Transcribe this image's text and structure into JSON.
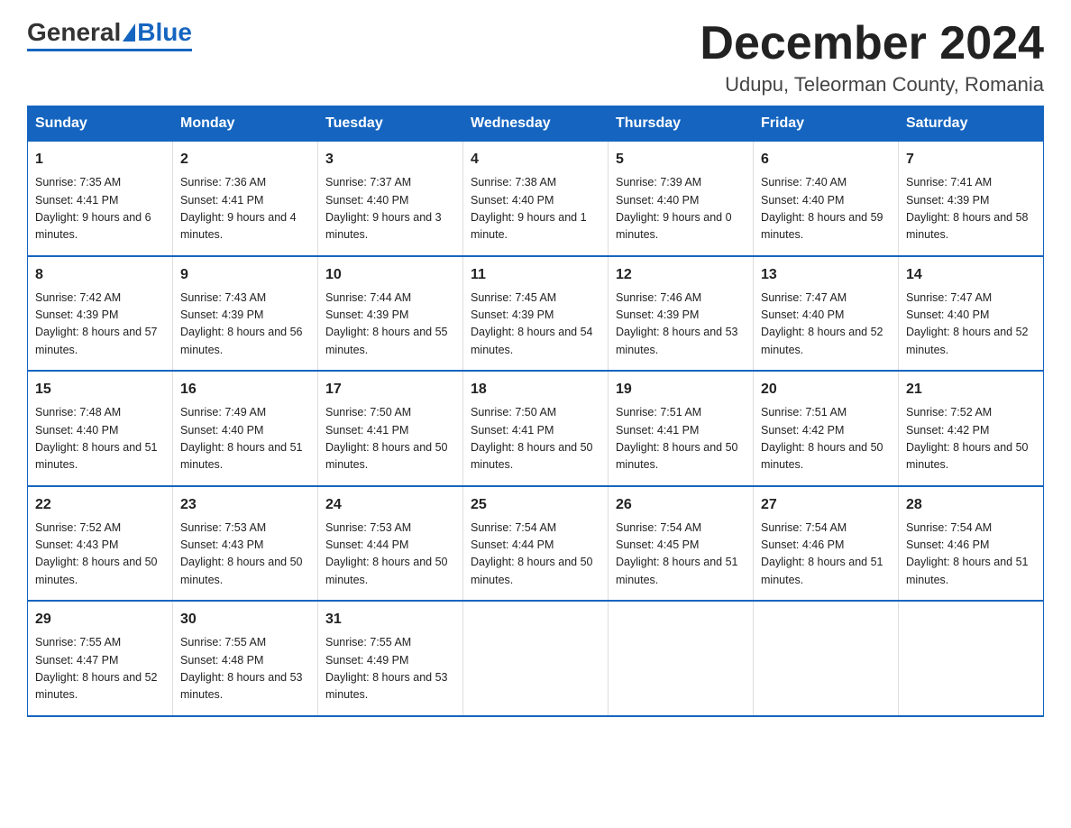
{
  "header": {
    "logo_general": "General",
    "logo_blue": "Blue",
    "month_title": "December 2024",
    "location": "Udupu, Teleorman County, Romania"
  },
  "weekdays": [
    "Sunday",
    "Monday",
    "Tuesday",
    "Wednesday",
    "Thursday",
    "Friday",
    "Saturday"
  ],
  "weeks": [
    [
      {
        "day": "1",
        "sunrise": "7:35 AM",
        "sunset": "4:41 PM",
        "daylight": "9 hours and 6 minutes."
      },
      {
        "day": "2",
        "sunrise": "7:36 AM",
        "sunset": "4:41 PM",
        "daylight": "9 hours and 4 minutes."
      },
      {
        "day": "3",
        "sunrise": "7:37 AM",
        "sunset": "4:40 PM",
        "daylight": "9 hours and 3 minutes."
      },
      {
        "day": "4",
        "sunrise": "7:38 AM",
        "sunset": "4:40 PM",
        "daylight": "9 hours and 1 minute."
      },
      {
        "day": "5",
        "sunrise": "7:39 AM",
        "sunset": "4:40 PM",
        "daylight": "9 hours and 0 minutes."
      },
      {
        "day": "6",
        "sunrise": "7:40 AM",
        "sunset": "4:40 PM",
        "daylight": "8 hours and 59 minutes."
      },
      {
        "day": "7",
        "sunrise": "7:41 AM",
        "sunset": "4:39 PM",
        "daylight": "8 hours and 58 minutes."
      }
    ],
    [
      {
        "day": "8",
        "sunrise": "7:42 AM",
        "sunset": "4:39 PM",
        "daylight": "8 hours and 57 minutes."
      },
      {
        "day": "9",
        "sunrise": "7:43 AM",
        "sunset": "4:39 PM",
        "daylight": "8 hours and 56 minutes."
      },
      {
        "day": "10",
        "sunrise": "7:44 AM",
        "sunset": "4:39 PM",
        "daylight": "8 hours and 55 minutes."
      },
      {
        "day": "11",
        "sunrise": "7:45 AM",
        "sunset": "4:39 PM",
        "daylight": "8 hours and 54 minutes."
      },
      {
        "day": "12",
        "sunrise": "7:46 AM",
        "sunset": "4:39 PM",
        "daylight": "8 hours and 53 minutes."
      },
      {
        "day": "13",
        "sunrise": "7:47 AM",
        "sunset": "4:40 PM",
        "daylight": "8 hours and 52 minutes."
      },
      {
        "day": "14",
        "sunrise": "7:47 AM",
        "sunset": "4:40 PM",
        "daylight": "8 hours and 52 minutes."
      }
    ],
    [
      {
        "day": "15",
        "sunrise": "7:48 AM",
        "sunset": "4:40 PM",
        "daylight": "8 hours and 51 minutes."
      },
      {
        "day": "16",
        "sunrise": "7:49 AM",
        "sunset": "4:40 PM",
        "daylight": "8 hours and 51 minutes."
      },
      {
        "day": "17",
        "sunrise": "7:50 AM",
        "sunset": "4:41 PM",
        "daylight": "8 hours and 50 minutes."
      },
      {
        "day": "18",
        "sunrise": "7:50 AM",
        "sunset": "4:41 PM",
        "daylight": "8 hours and 50 minutes."
      },
      {
        "day": "19",
        "sunrise": "7:51 AM",
        "sunset": "4:41 PM",
        "daylight": "8 hours and 50 minutes."
      },
      {
        "day": "20",
        "sunrise": "7:51 AM",
        "sunset": "4:42 PM",
        "daylight": "8 hours and 50 minutes."
      },
      {
        "day": "21",
        "sunrise": "7:52 AM",
        "sunset": "4:42 PM",
        "daylight": "8 hours and 50 minutes."
      }
    ],
    [
      {
        "day": "22",
        "sunrise": "7:52 AM",
        "sunset": "4:43 PM",
        "daylight": "8 hours and 50 minutes."
      },
      {
        "day": "23",
        "sunrise": "7:53 AM",
        "sunset": "4:43 PM",
        "daylight": "8 hours and 50 minutes."
      },
      {
        "day": "24",
        "sunrise": "7:53 AM",
        "sunset": "4:44 PM",
        "daylight": "8 hours and 50 minutes."
      },
      {
        "day": "25",
        "sunrise": "7:54 AM",
        "sunset": "4:44 PM",
        "daylight": "8 hours and 50 minutes."
      },
      {
        "day": "26",
        "sunrise": "7:54 AM",
        "sunset": "4:45 PM",
        "daylight": "8 hours and 51 minutes."
      },
      {
        "day": "27",
        "sunrise": "7:54 AM",
        "sunset": "4:46 PM",
        "daylight": "8 hours and 51 minutes."
      },
      {
        "day": "28",
        "sunrise": "7:54 AM",
        "sunset": "4:46 PM",
        "daylight": "8 hours and 51 minutes."
      }
    ],
    [
      {
        "day": "29",
        "sunrise": "7:55 AM",
        "sunset": "4:47 PM",
        "daylight": "8 hours and 52 minutes."
      },
      {
        "day": "30",
        "sunrise": "7:55 AM",
        "sunset": "4:48 PM",
        "daylight": "8 hours and 53 minutes."
      },
      {
        "day": "31",
        "sunrise": "7:55 AM",
        "sunset": "4:49 PM",
        "daylight": "8 hours and 53 minutes."
      },
      null,
      null,
      null,
      null
    ]
  ]
}
